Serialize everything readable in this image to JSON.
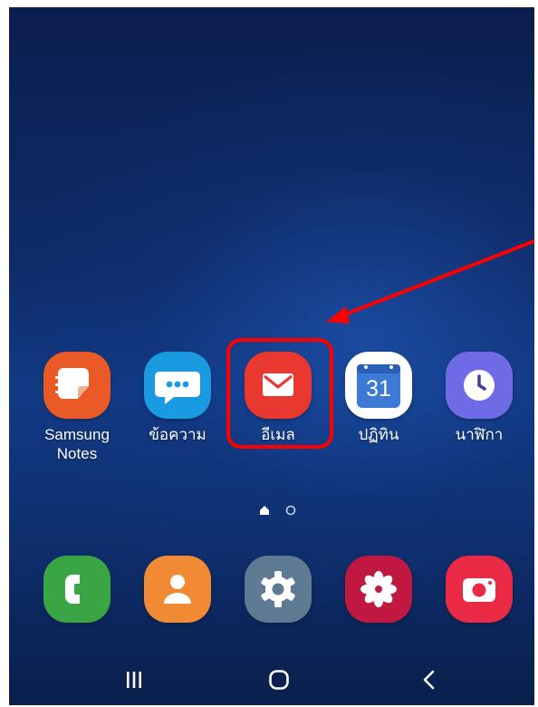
{
  "apps": [
    {
      "label": "Samsung Notes",
      "icon": "samsung-notes-icon",
      "color": "#ea5a26"
    },
    {
      "label": "ข้อความ",
      "icon": "chat-bubble-icon",
      "color": "#1a9ae0"
    },
    {
      "label": "อีเมล",
      "icon": "envelope-icon",
      "color": "#e8382f"
    },
    {
      "label": "ปฏิทิน",
      "icon": "calendar-icon",
      "color": "#ffffff",
      "date": "31"
    },
    {
      "label": "นาฬิกา",
      "icon": "clock-icon",
      "color": "#6f6ae6"
    }
  ],
  "dock": [
    {
      "icon": "phone-icon",
      "color": "#3aa545"
    },
    {
      "icon": "contacts-icon",
      "color": "#f08a34"
    },
    {
      "icon": "gear-icon",
      "color": "#5f7b94"
    },
    {
      "icon": "flower-icon",
      "color": "#c01840"
    },
    {
      "icon": "camera-icon",
      "color": "#ea2a45"
    }
  ],
  "pager": {
    "pages": 2,
    "current": 1
  },
  "nav": {
    "recents": "recent-apps-icon",
    "home": "home-icon",
    "back": "back-icon"
  },
  "annotation": {
    "color": "#ff0000"
  }
}
